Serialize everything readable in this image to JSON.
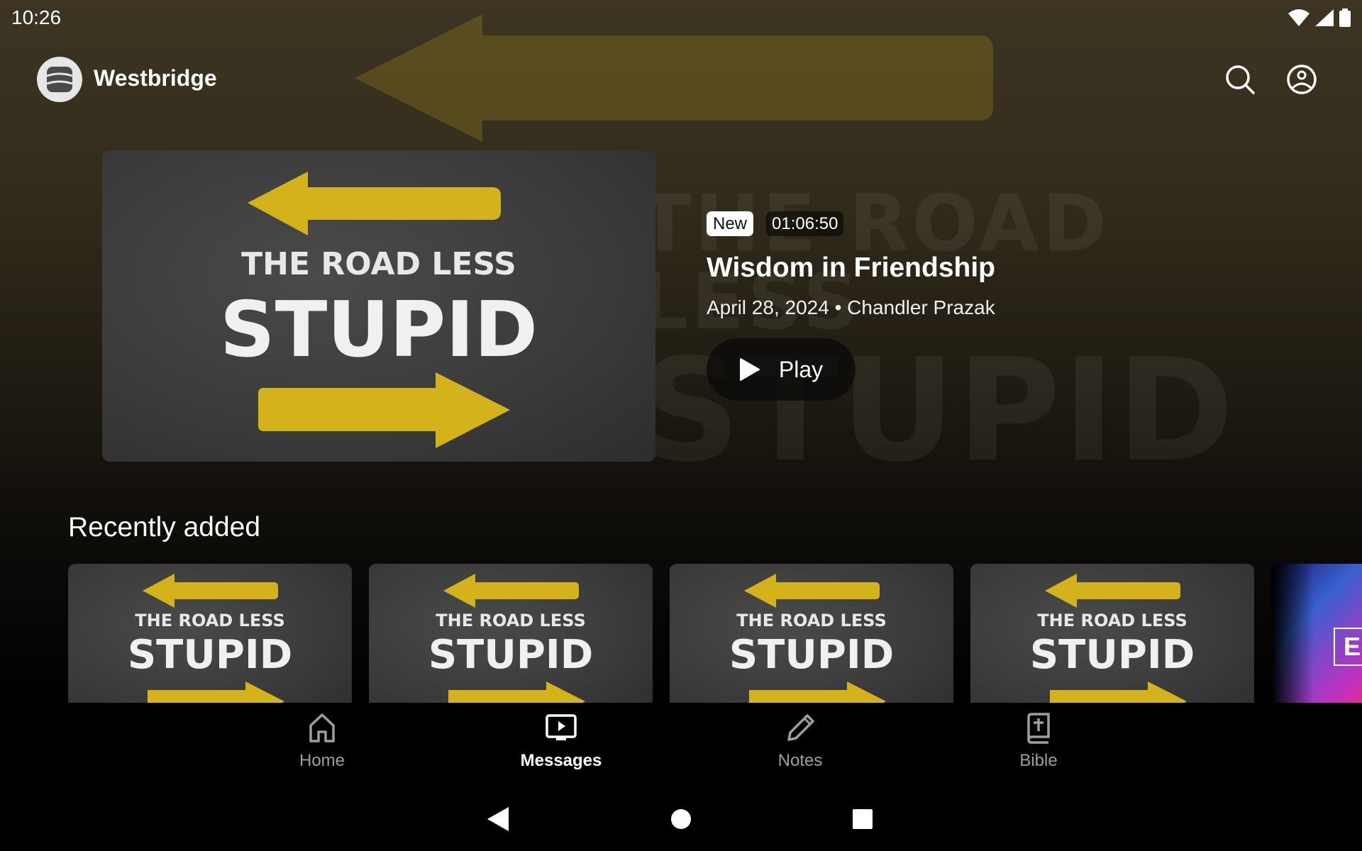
{
  "status_bar": {
    "time": "10:26",
    "icons": [
      "wifi-icon",
      "signal-icon",
      "battery-icon"
    ]
  },
  "app_bar": {
    "brand": "Westbridge",
    "logo_icon": "westbridge-logo-icon",
    "actions": [
      {
        "name": "search",
        "icon": "search-icon"
      },
      {
        "name": "profile",
        "icon": "account-circle-icon"
      }
    ]
  },
  "hero": {
    "artwork": {
      "line1": "THE ROAD LESS",
      "line2": "STUPID"
    },
    "badge_new": "New",
    "duration": "01:06:50",
    "title": "Wisdom in Friendship",
    "meta": "April 28, 2024 • Chandler Prazak",
    "play_label": "Play"
  },
  "recently_added": {
    "title": "Recently added",
    "items": [
      {
        "art_line1": "THE ROAD LESS",
        "art_line2": "STUPID"
      },
      {
        "art_line1": "THE ROAD LESS",
        "art_line2": "STUPID"
      },
      {
        "art_line1": "THE ROAD LESS",
        "art_line2": "STUPID"
      },
      {
        "art_line1": "THE ROAD LESS",
        "art_line2": "STUPID"
      },
      {
        "art_letter": "E"
      }
    ]
  },
  "bottom_nav": {
    "items": [
      {
        "label": "Home",
        "icon": "home-icon",
        "active": false
      },
      {
        "label": "Messages",
        "icon": "messages-icon",
        "active": true
      },
      {
        "label": "Notes",
        "icon": "pencil-icon",
        "active": false
      },
      {
        "label": "Bible",
        "icon": "bible-icon",
        "active": false
      }
    ]
  },
  "colors": {
    "accent_yellow": "#d4b21c",
    "inactive_nav": "#9e9e9e",
    "active_nav": "#ffffff"
  }
}
